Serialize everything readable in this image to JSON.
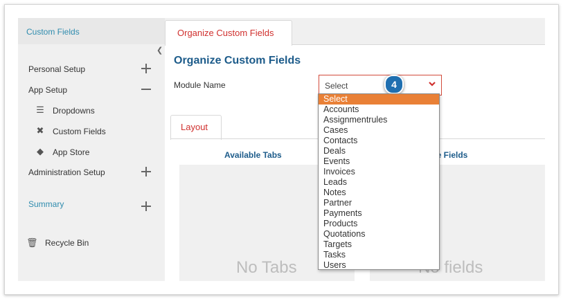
{
  "sidebar": {
    "header": "Custom Fields",
    "items": [
      {
        "label": "Personal Setup",
        "sign": "plus"
      },
      {
        "label": "App Setup",
        "sign": "minus"
      },
      {
        "label": "Administration Setup",
        "sign": "plus"
      },
      {
        "label": "Summary",
        "sign": "plus"
      },
      {
        "label": "Recycle Bin"
      }
    ],
    "subitems": [
      {
        "label": "Dropdowns",
        "icon": "list-icon"
      },
      {
        "label": "Custom Fields",
        "icon": "wrench-icon"
      },
      {
        "label": "App Store",
        "icon": "app-store-icon"
      }
    ]
  },
  "main": {
    "tab": "Organize Custom Fields",
    "title": "Organize Custom Fields",
    "module_label": "Module Name",
    "select_value": "Select",
    "badge": "4",
    "layout_tab": "Layout",
    "available_tabs": "Available Tabs",
    "right_header": "se Fields",
    "no_tabs": "No Tabs",
    "no_fields": "No fields"
  },
  "dropdown_options": [
    "Select",
    "Accounts",
    "Assignmentrules",
    "Cases",
    "Contacts",
    "Deals",
    "Events",
    "Invoices",
    "Leads",
    "Notes",
    "Partner",
    "Payments",
    "Products",
    "Quotations",
    "Targets",
    "Tasks",
    "Users"
  ],
  "colors": {
    "accent": "#d0302e",
    "link": "#2f8cae",
    "title": "#1c5b8a",
    "selected": "#e98036",
    "badge": "#1f6fb0"
  }
}
